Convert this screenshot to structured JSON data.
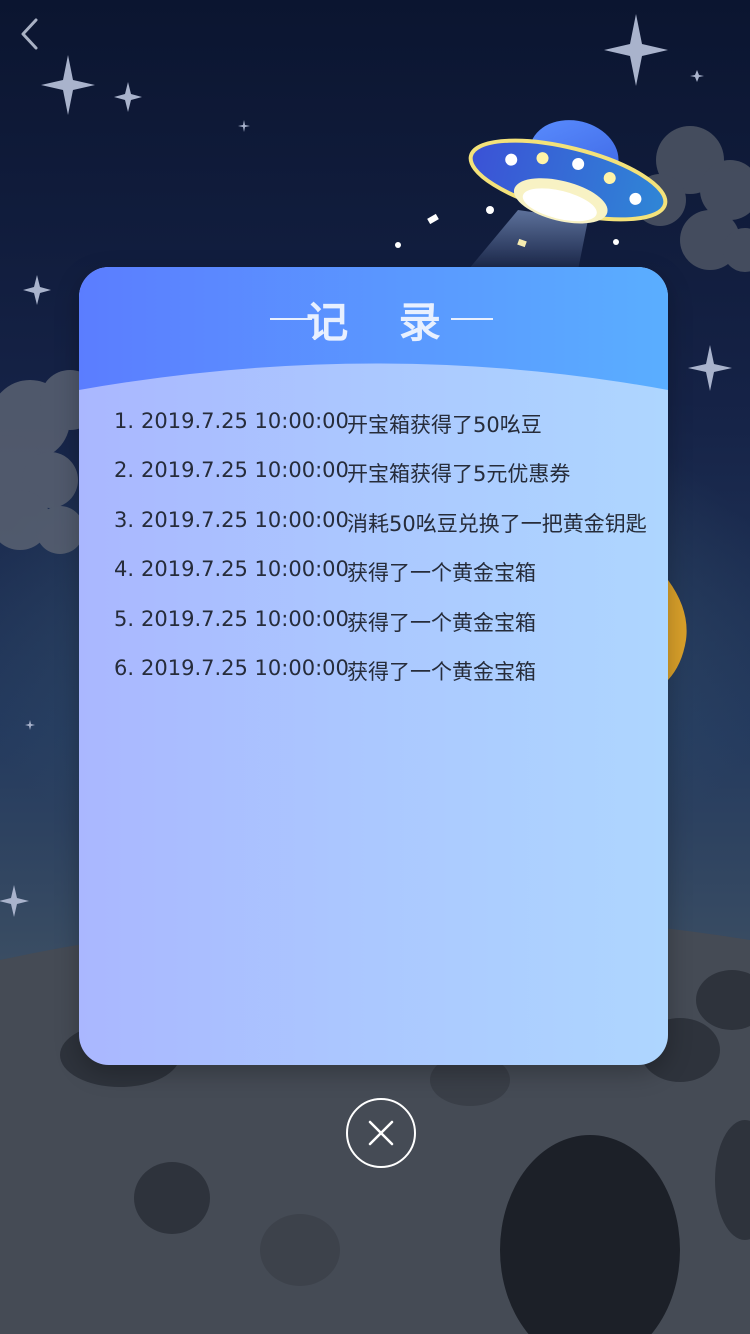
{
  "nav": {
    "back_icon": "chevron-left-icon"
  },
  "dialog": {
    "title": "记 录",
    "records": [
      {
        "index": "1.",
        "time": "2019.7.25 10:00:00",
        "desc": "开宝箱获得了50吆豆"
      },
      {
        "index": "2.",
        "time": "2019.7.25 10:00:00",
        "desc": "开宝箱获得了5元优惠券"
      },
      {
        "index": "3.",
        "time": "2019.7.25 10:00:00",
        "desc": "消耗50吆豆兑换了一把黄金钥匙"
      },
      {
        "index": "4.",
        "time": "2019.7.25 10:00:00",
        "desc": "获得了一个黄金宝箱"
      },
      {
        "index": "5.",
        "time": "2019.7.25 10:00:00",
        "desc": "获得了一个黄金宝箱"
      },
      {
        "index": "6.",
        "time": "2019.7.25 10:00:00",
        "desc": "获得了一个黄金宝箱"
      }
    ],
    "close_icon": "close-icon"
  },
  "colors": {
    "header_left": "#5b7dff",
    "header_right": "#5aaeff",
    "body_left": "#aab7ff",
    "body_right": "#aed6ff",
    "text": "#262c3a"
  }
}
